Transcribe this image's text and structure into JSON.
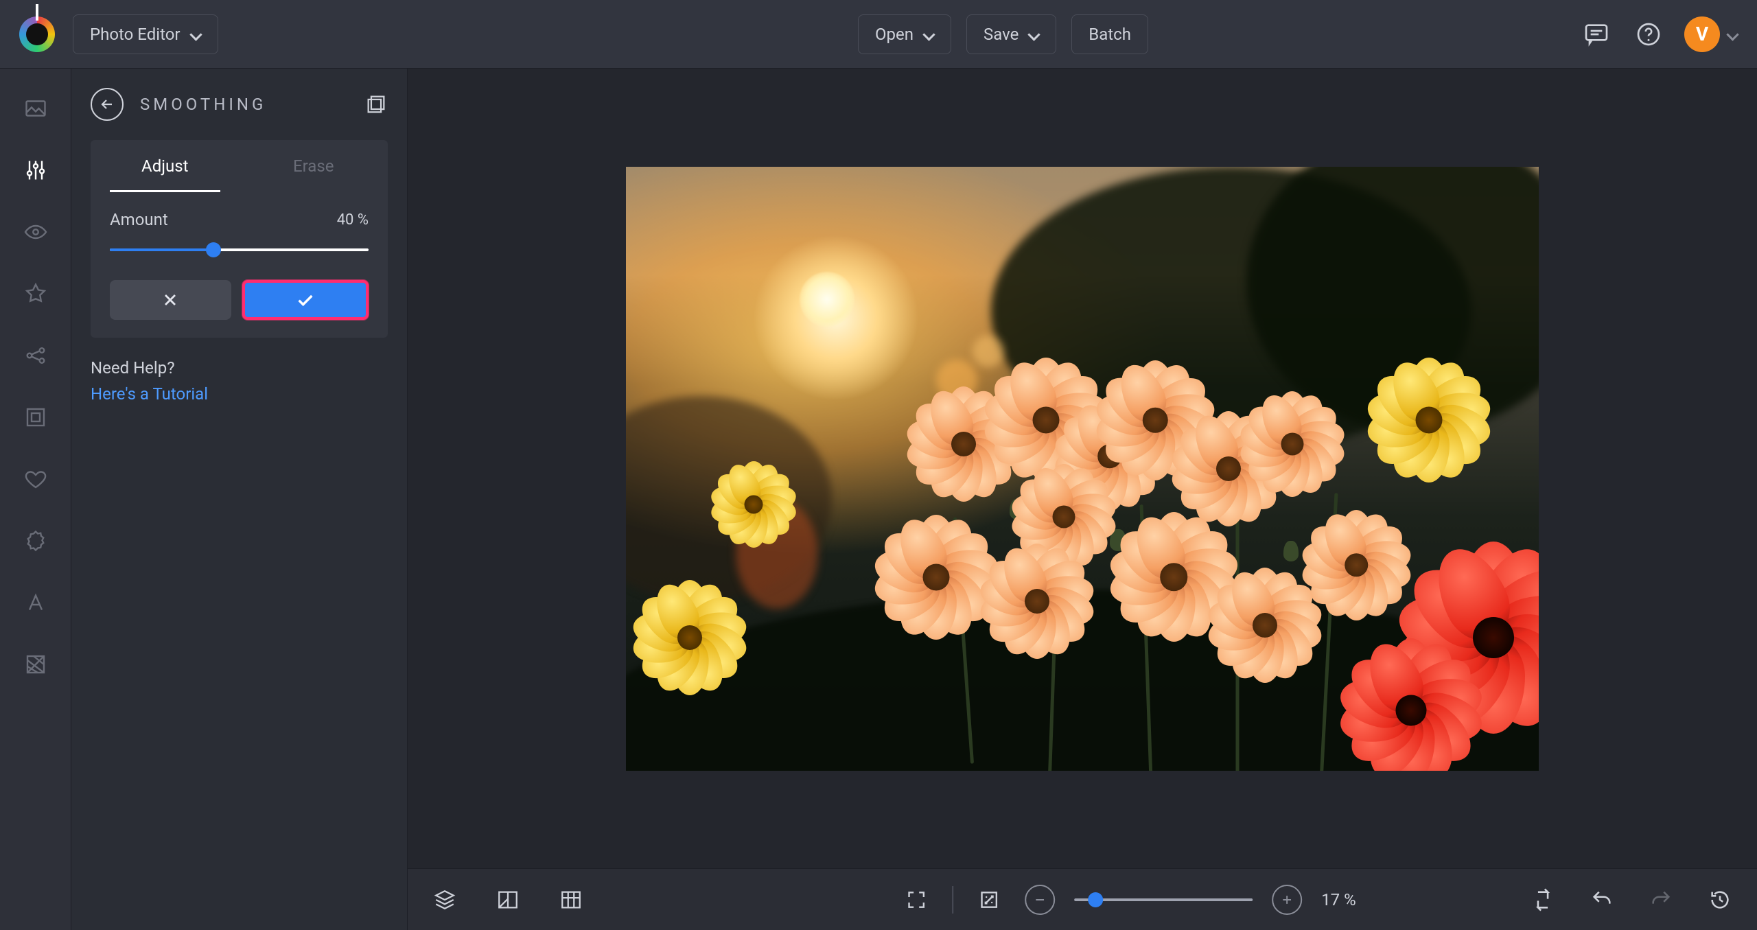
{
  "header": {
    "app_switcher": "Photo Editor",
    "open": "Open",
    "save": "Save",
    "batch": "Batch",
    "avatar_initial": "V"
  },
  "rail": {
    "items": [
      {
        "name": "image-tool"
      },
      {
        "name": "adjust-tool",
        "active": true
      },
      {
        "name": "eye-tool"
      },
      {
        "name": "star-tool"
      },
      {
        "name": "nodes-tool"
      },
      {
        "name": "frame-tool"
      },
      {
        "name": "heart-tool"
      },
      {
        "name": "badge-tool"
      },
      {
        "name": "text-tool"
      },
      {
        "name": "texture-tool"
      }
    ]
  },
  "panel": {
    "title": "SMOOTHING",
    "tabs": {
      "adjust": "Adjust",
      "erase": "Erase",
      "active": "adjust"
    },
    "amount": {
      "label": "Amount",
      "value": "40 %",
      "percent": 40
    },
    "help": {
      "q": "Need Help?",
      "link": "Here's a Tutorial"
    }
  },
  "bottombar": {
    "zoom_percent": "17 %",
    "zoom_slider_percent": 12
  }
}
